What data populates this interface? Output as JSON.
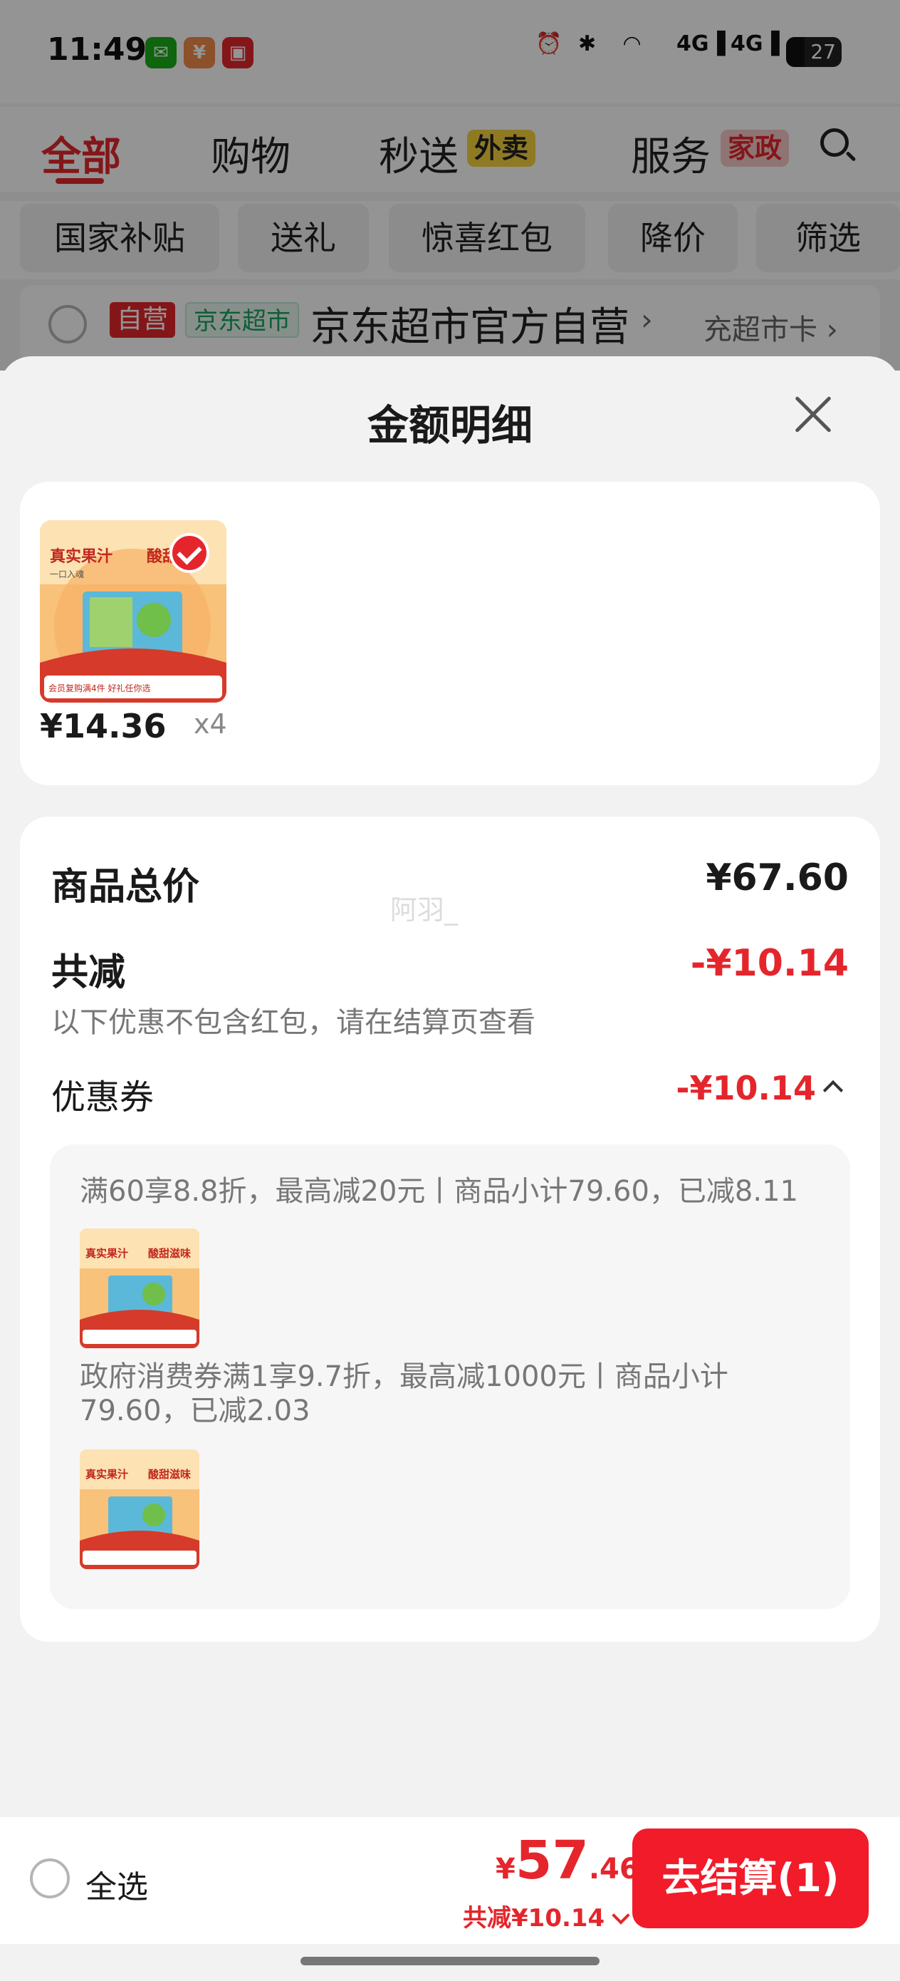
{
  "status_bar": {
    "time": "11:49",
    "network1": "4G",
    "network2": "4G",
    "battery": "27"
  },
  "top_tabs": [
    {
      "label": "全部"
    },
    {
      "label": "购物"
    },
    {
      "label": "秒送",
      "badge": "外卖"
    },
    {
      "label": "服务",
      "badge": "家政"
    }
  ],
  "filter_chips": [
    "国家补贴",
    "送礼",
    "惊喜红包",
    "降价",
    "筛选"
  ],
  "store": {
    "tag_self": "自营",
    "tag_jd": "京东超市",
    "name": "京东超市官方自营",
    "arrow": "›",
    "card_link": "充超市卡 ›"
  },
  "sheet": {
    "title": "金额明细",
    "product": {
      "price": "¥14.36",
      "qty": "x4"
    },
    "product_image_text": {
      "a": "真实果汁",
      "b": "酸甜滋味",
      "c": "一口入魂",
      "d": "会员复购满4件 好礼任你选"
    },
    "summary": {
      "total_label": "商品总价",
      "total_value": "¥67.60",
      "reduce_label": "共减",
      "reduce_value": "-¥10.14",
      "note": "以下优惠不包含红包，请在结算页查看",
      "watermark": "阿羽_",
      "coupon_label": "优惠券",
      "coupon_value": "-¥10.14"
    },
    "coupon_details": [
      "满60享8.8折，最高减20元丨商品小计79.60，已减8.11",
      "政府消费券满1享9.7折，最高减1000元丨商品小计79.60，已减2.03"
    ]
  },
  "bottom_bar": {
    "select_all": "全选",
    "price_symbol": "¥",
    "price_int": "57",
    "price_dec": ".46",
    "saving": "共减¥10.14",
    "checkout": "去结算(1)"
  },
  "colors": {
    "accent": "#e4262c",
    "checkout": "#f11b2a",
    "jd_green": "#19a35e"
  }
}
